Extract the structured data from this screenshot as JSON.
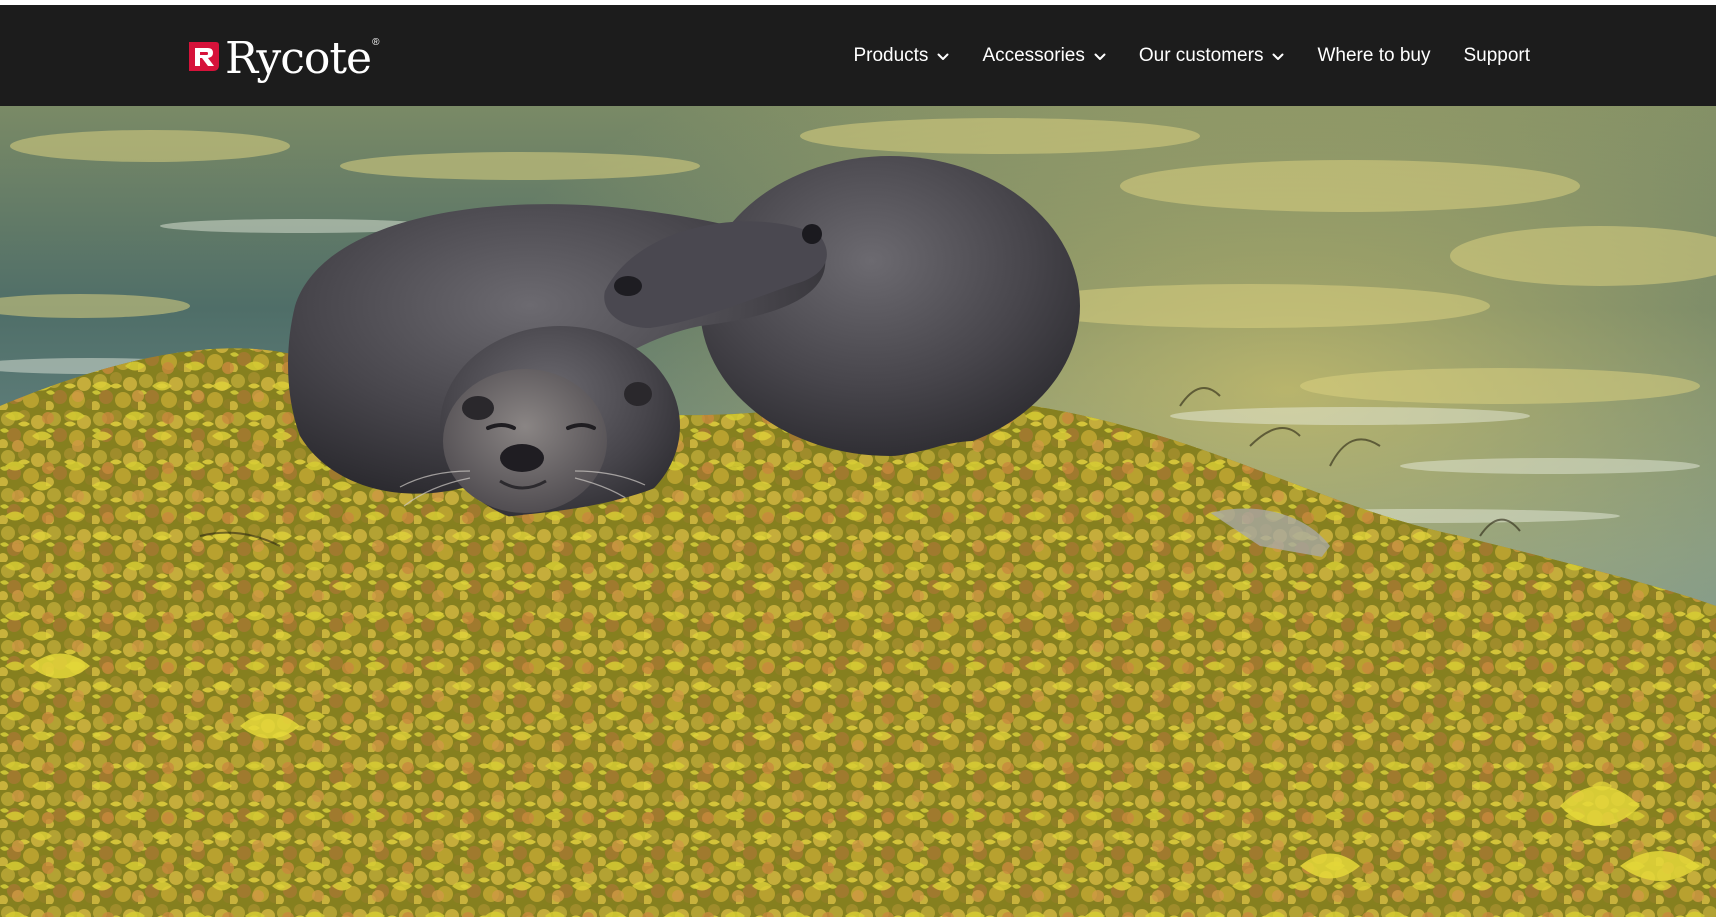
{
  "brand": {
    "name": "Rycote",
    "registered_mark": "®",
    "accent_color": "#d6123a",
    "logo_icon": "rycote-r-icon"
  },
  "nav": {
    "items": [
      {
        "label": "Products",
        "has_dropdown": true,
        "icon": "chevron-down-icon"
      },
      {
        "label": "Accessories",
        "has_dropdown": true,
        "icon": "chevron-down-icon"
      },
      {
        "label": "Our customers",
        "has_dropdown": true,
        "icon": "chevron-down-icon"
      },
      {
        "label": "Where to buy",
        "has_dropdown": false
      },
      {
        "label": "Support",
        "has_dropdown": false
      }
    ]
  },
  "colors": {
    "header_bg": "#1c1c1c",
    "nav_text": "#ffffff"
  }
}
